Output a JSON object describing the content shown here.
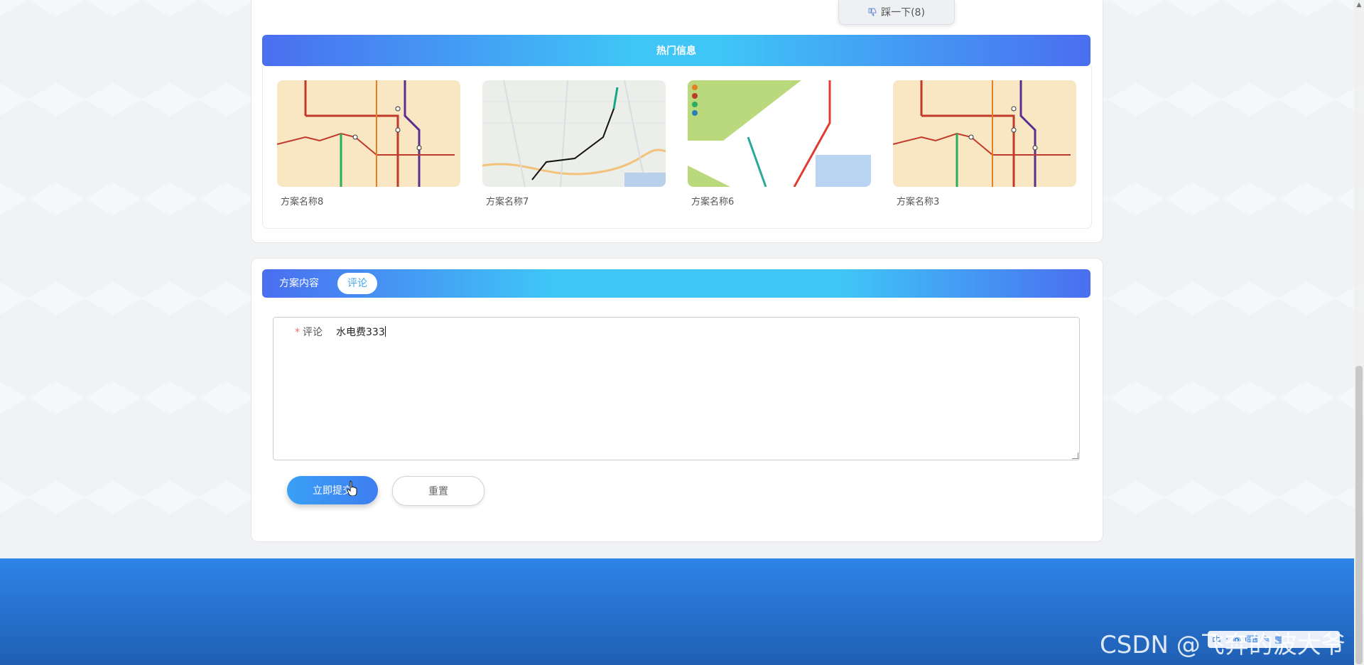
{
  "top_card": {
    "dislike_label": "踩一下(8)"
  },
  "hot": {
    "title": "热门信息",
    "items": [
      {
        "caption": "方案名称8",
        "image": "metro-map-thumbnail"
      },
      {
        "caption": "方案名称7",
        "image": "city-map-thumbnail"
      },
      {
        "caption": "方案名称6",
        "image": "transit-diagram-thumbnail"
      },
      {
        "caption": "方案名称3",
        "image": "metro-map-thumbnail"
      }
    ]
  },
  "tabs": {
    "content": "方案内容",
    "comment": "评论"
  },
  "comment_form": {
    "required_mark": "*",
    "label": "评论",
    "value": "水电费333",
    "submit": "立即提交",
    "reset": "重置"
  },
  "watermark": {
    "text": "CSDN @飞奔的波大爷"
  },
  "colors": {
    "header_blue": "#4a6ef0",
    "header_cyan": "#3fc6f7",
    "footer_blue": "#2f84e8",
    "required_red": "#f56c6c"
  }
}
